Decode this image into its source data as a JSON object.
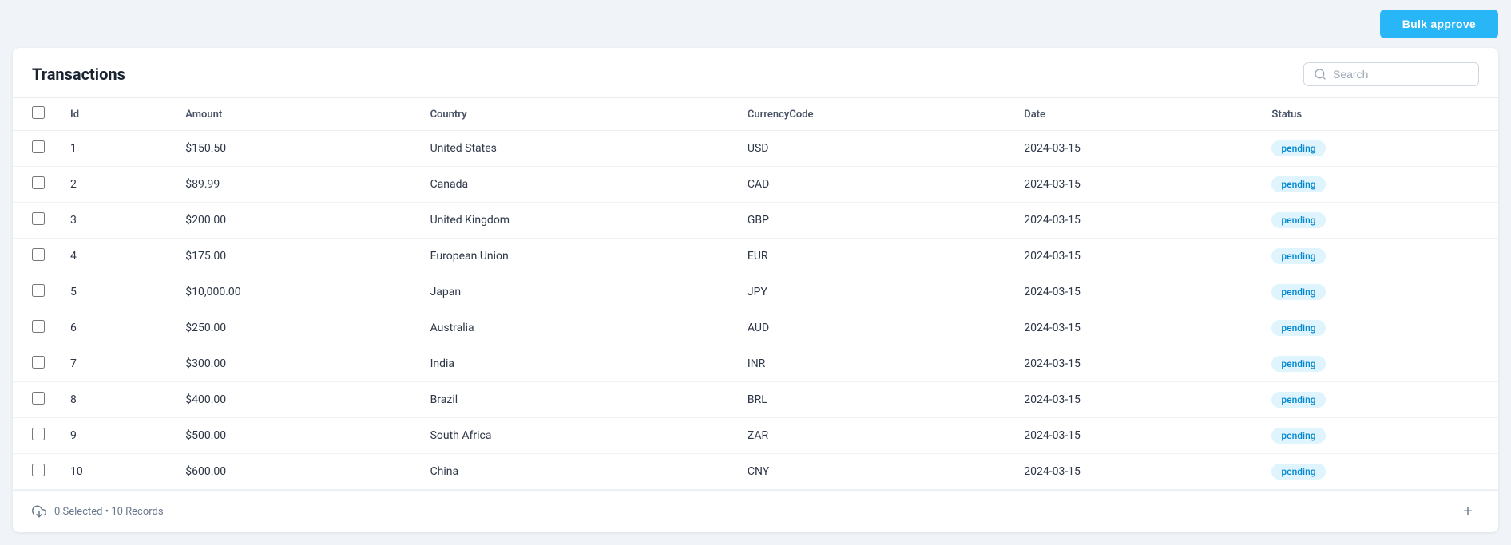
{
  "topbar": {
    "bulk_approve_label": "Bulk approve"
  },
  "table": {
    "title": "Transactions",
    "search_placeholder": "Search",
    "columns": [
      {
        "key": "checkbox",
        "label": ""
      },
      {
        "key": "id",
        "label": "Id"
      },
      {
        "key": "amount",
        "label": "Amount"
      },
      {
        "key": "country",
        "label": "Country"
      },
      {
        "key": "currency_code",
        "label": "CurrencyCode"
      },
      {
        "key": "date",
        "label": "Date"
      },
      {
        "key": "status",
        "label": "Status"
      }
    ],
    "rows": [
      {
        "id": "1",
        "amount": "$150.50",
        "country": "United States",
        "currency_code": "USD",
        "date": "2024-03-15",
        "status": "pending"
      },
      {
        "id": "2",
        "amount": "$89.99",
        "country": "Canada",
        "currency_code": "CAD",
        "date": "2024-03-15",
        "status": "pending"
      },
      {
        "id": "3",
        "amount": "$200.00",
        "country": "United Kingdom",
        "currency_code": "GBP",
        "date": "2024-03-15",
        "status": "pending"
      },
      {
        "id": "4",
        "amount": "$175.00",
        "country": "European Union",
        "currency_code": "EUR",
        "date": "2024-03-15",
        "status": "pending"
      },
      {
        "id": "5",
        "amount": "$10,000.00",
        "country": "Japan",
        "currency_code": "JPY",
        "date": "2024-03-15",
        "status": "pending"
      },
      {
        "id": "6",
        "amount": "$250.00",
        "country": "Australia",
        "currency_code": "AUD",
        "date": "2024-03-15",
        "status": "pending"
      },
      {
        "id": "7",
        "amount": "$300.00",
        "country": "India",
        "currency_code": "INR",
        "date": "2024-03-15",
        "status": "pending"
      },
      {
        "id": "8",
        "amount": "$400.00",
        "country": "Brazil",
        "currency_code": "BRL",
        "date": "2024-03-15",
        "status": "pending"
      },
      {
        "id": "9",
        "amount": "$500.00",
        "country": "South Africa",
        "currency_code": "ZAR",
        "date": "2024-03-15",
        "status": "pending"
      },
      {
        "id": "10",
        "amount": "$600.00",
        "country": "China",
        "currency_code": "CNY",
        "date": "2024-03-15",
        "status": "pending"
      }
    ],
    "footer": {
      "selected_count": "0 Selected",
      "record_count": "10 Records",
      "footer_text": "0 Selected • 10 Records"
    }
  }
}
